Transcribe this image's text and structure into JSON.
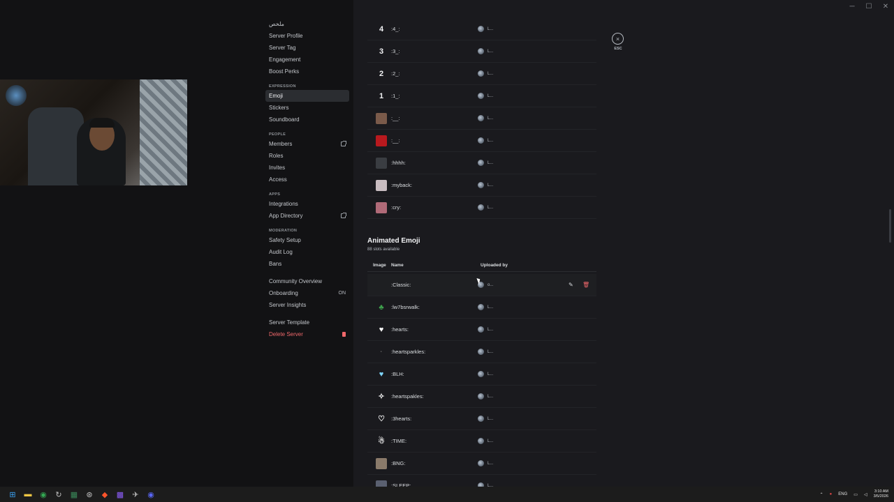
{
  "window": {
    "minimize": "─",
    "maximize": "☐",
    "close": "✕"
  },
  "sidebar": {
    "groups": [
      {
        "heading": "",
        "items": [
          {
            "label": "ملخص",
            "key": "overview"
          },
          {
            "label": "Server Profile",
            "key": "server-profile"
          },
          {
            "label": "Server Tag",
            "key": "server-tag"
          },
          {
            "label": "Engagement",
            "key": "engagement"
          },
          {
            "label": "Boost Perks",
            "key": "boost-perks"
          }
        ]
      },
      {
        "heading": "EXPRESSION",
        "items": [
          {
            "label": "Emoji",
            "key": "emoji",
            "active": true
          },
          {
            "label": "Stickers",
            "key": "stickers"
          },
          {
            "label": "Soundboard",
            "key": "soundboard"
          }
        ]
      },
      {
        "heading": "PEOPLE",
        "items": [
          {
            "label": "Members",
            "key": "members",
            "external": true
          },
          {
            "label": "Roles",
            "key": "roles"
          },
          {
            "label": "Invites",
            "key": "invites"
          },
          {
            "label": "Access",
            "key": "access"
          }
        ]
      },
      {
        "heading": "APPS",
        "items": [
          {
            "label": "Integrations",
            "key": "integrations"
          },
          {
            "label": "App Directory",
            "key": "app-directory",
            "external": true
          }
        ]
      },
      {
        "heading": "MODERATION",
        "items": [
          {
            "label": "Safety Setup",
            "key": "safety-setup"
          },
          {
            "label": "Audit Log",
            "key": "audit-log"
          },
          {
            "label": "Bans",
            "key": "bans"
          }
        ]
      },
      {
        "heading": "",
        "items": [
          {
            "label": "Community Overview",
            "key": "community-overview"
          },
          {
            "label": "Onboarding",
            "key": "onboarding",
            "badge": "ON"
          },
          {
            "label": "Server Insights",
            "key": "server-insights"
          }
        ]
      },
      {
        "heading": "",
        "items": [
          {
            "label": "Server Template",
            "key": "server-template"
          },
          {
            "label": "Delete Server",
            "key": "delete-server",
            "danger": true
          }
        ]
      }
    ]
  },
  "static_emoji": [
    {
      "glyph": "4",
      "name": ":4_:",
      "uploader": "L..."
    },
    {
      "glyph": "3",
      "name": ":3_:",
      "uploader": "L..."
    },
    {
      "glyph": "2",
      "name": ":2_:",
      "uploader": "L..."
    },
    {
      "glyph": "1",
      "name": ":1_:",
      "uploader": "L..."
    },
    {
      "glyph": "",
      "name": ":__:",
      "uploader": "L...",
      "color": "#7a5a4a"
    },
    {
      "glyph": "",
      "name": ":__:",
      "uploader": "L...",
      "color": "#b8191e"
    },
    {
      "glyph": "",
      "name": ":hhhh:",
      "uploader": "L...",
      "color": "#3a3d42"
    },
    {
      "glyph": "",
      "name": ":myback:",
      "uploader": "L...",
      "color": "#c8bcc0"
    },
    {
      "glyph": "",
      "name": ":cry:",
      "uploader": "L...",
      "color": "#b06a78"
    }
  ],
  "animated": {
    "title": "Animated Emoji",
    "subtitle": "88 slots available",
    "headers": {
      "image": "Image",
      "name": "Name",
      "uploaded_by": "Uploaded by"
    },
    "rows": [
      {
        "glyph": "",
        "name": ":Classic:",
        "uploader": "o...",
        "hover": true,
        "color": "transparent"
      },
      {
        "glyph": "♣",
        "name": ":lw7bsrwalk:",
        "uploader": "L...",
        "color": "transparent",
        "fg": "#3fa34d"
      },
      {
        "glyph": "♥",
        "name": ":hearts:",
        "uploader": "L...",
        "color": "transparent",
        "fg": "#ffffff"
      },
      {
        "glyph": "·",
        "name": ":heartsparkles:",
        "uploader": "L...",
        "color": "transparent",
        "fg": "#555"
      },
      {
        "glyph": "♥",
        "name": ":BLH:",
        "uploader": "L...",
        "color": "transparent",
        "fg": "#7fd6ff"
      },
      {
        "glyph": "✧",
        "name": ":heartspakles:",
        "uploader": "L...",
        "color": "transparent",
        "fg": "#ffffff"
      },
      {
        "glyph": "♡",
        "name": ":3hearts:",
        "uploader": "L...",
        "color": "transparent",
        "fg": "#ffffff"
      },
      {
        "glyph": "☃",
        "name": ":TIME:",
        "uploader": "L...",
        "color": "transparent",
        "fg": "#e0e0e0"
      },
      {
        "glyph": "",
        "name": ":BNG:",
        "uploader": "L...",
        "color": "#8a7a6a"
      },
      {
        "glyph": "",
        "name": ":SLEEP:",
        "uploader": "L...",
        "color": "#5a6070"
      }
    ]
  },
  "close": {
    "label": "ESC",
    "icon": "×"
  },
  "taskbar": {
    "icons": [
      {
        "name": "windows-start-icon",
        "glyph": "⊞",
        "color": "#3aa0f0"
      },
      {
        "name": "file-explorer-icon",
        "glyph": "▬",
        "color": "#f2c744"
      },
      {
        "name": "chrome-icon",
        "glyph": "◉",
        "color": "#34a853"
      },
      {
        "name": "app-icon-1",
        "glyph": "↻",
        "color": "#c0c0c0"
      },
      {
        "name": "app-icon-2",
        "glyph": "▦",
        "color": "#3a8a5a"
      },
      {
        "name": "app-icon-3",
        "glyph": "⊛",
        "color": "#c0c0c0"
      },
      {
        "name": "brave-icon",
        "glyph": "◆",
        "color": "#fb542b"
      },
      {
        "name": "app-icon-4",
        "glyph": "▩",
        "color": "#8a5cf5"
      },
      {
        "name": "steam-icon",
        "glyph": "✈",
        "color": "#c0c0c0"
      },
      {
        "name": "discord-icon",
        "glyph": "◉",
        "color": "#5865f2"
      }
    ],
    "lang": "ENG",
    "time": "3:10 AM",
    "date": "3/5/2026"
  }
}
